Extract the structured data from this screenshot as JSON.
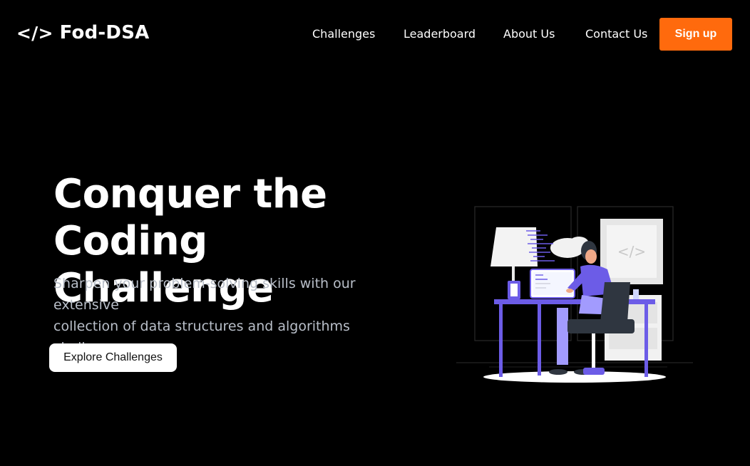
{
  "nav": {
    "brand_icon": "</>",
    "brand_name": "Fod-DSA",
    "links": [
      "Challenges",
      "Leaderboard",
      "About Us",
      "Contact Us"
    ],
    "signup_label": "Sign up"
  },
  "hero": {
    "title_line1": "Conquer the",
    "title_line2": "Coding Challenge",
    "subtitle_line1": "Sharpen your problem-solving skills with our extensive",
    "subtitle_line2": "collection of data structures and algorithms challenges.",
    "cta_label": "Explore Challenges"
  },
  "illustration": {
    "screen_code_glyph": "</>",
    "icon": "developer-at-desk-illustration"
  },
  "colors": {
    "background": "#000000",
    "accent": "#ff6a0d",
    "illustration_purple": "#6c5ce7",
    "text_primary": "#ffffff",
    "text_muted": "#b9bfc9"
  }
}
